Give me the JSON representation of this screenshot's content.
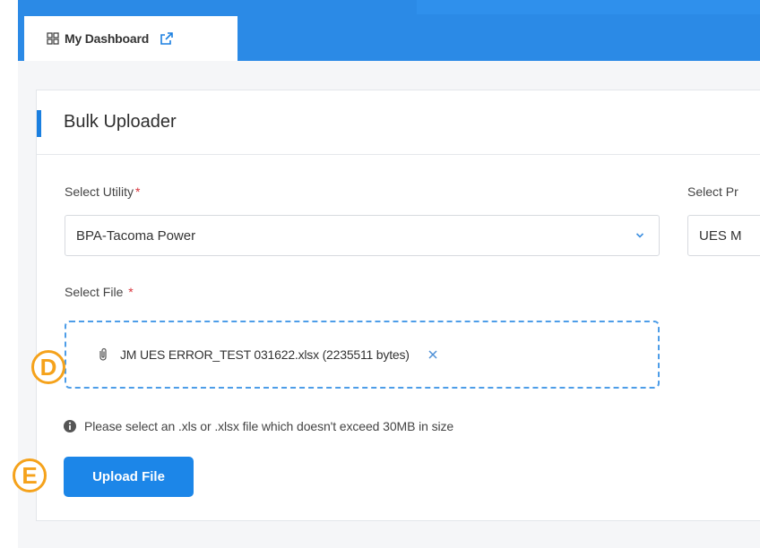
{
  "tab": {
    "label": "My Dashboard",
    "icons": [
      "dashboard-grid-icon",
      "external-link-icon"
    ]
  },
  "card": {
    "title": "Bulk Uploader"
  },
  "form": {
    "utility": {
      "label": "Select Utility",
      "required_mark": "*",
      "value": "BPA-Tacoma Power"
    },
    "program": {
      "label": "Select Pr",
      "value": "UES M"
    },
    "file": {
      "label": "Select File",
      "required_mark": "*",
      "selected_file": "JM UES ERROR_TEST 031622.xlsx (2235511 bytes)"
    },
    "hint": "Please select an .xls or .xlsx file which doesn't exceed 30MB in size",
    "upload_label": "Upload File"
  },
  "annotations": {
    "marker_d": "D",
    "marker_e": "E"
  },
  "colors": {
    "primary": "#1c86e8",
    "topbar": "#2b8ae6",
    "required": "#d9363e",
    "marker": "#f5a21b"
  }
}
